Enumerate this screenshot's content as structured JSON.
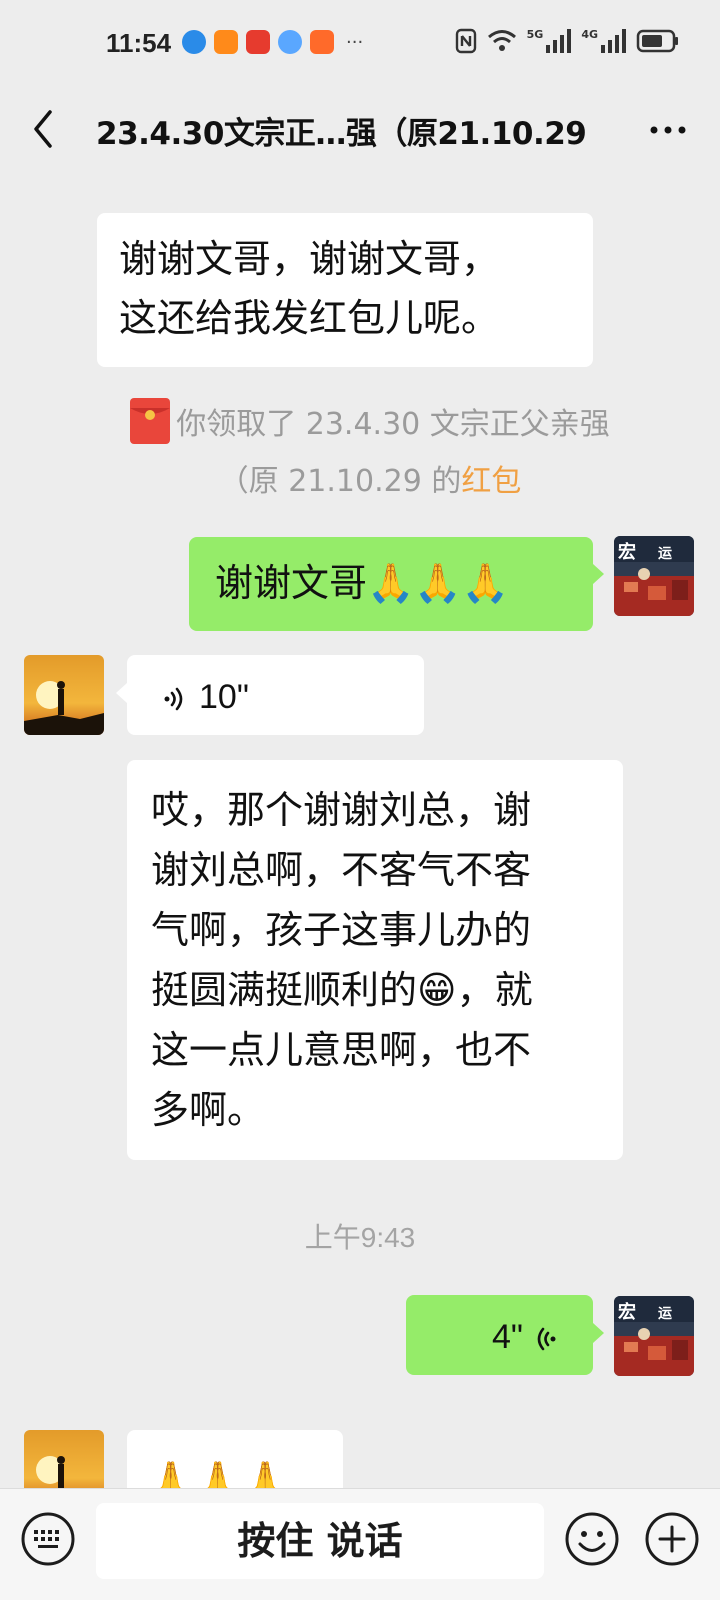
{
  "status_bar": {
    "time": "11:54",
    "more_apps": "···",
    "net1": "5G",
    "net2": "4G"
  },
  "header": {
    "title": "23.4.30文宗正…强（原21.10.29",
    "back_icon": "chevron-left-icon",
    "more_icon": "ellipsis-icon"
  },
  "messages": {
    "m1_text_l1": "谢谢文哥，谢谢文哥，",
    "m1_text_l2": "这还给我发红包儿呢。",
    "system_line1": "你领取了 23.4.30 文宗正父亲强",
    "system_line2_prefix": "（原 21.10.29 的",
    "system_link": "红包",
    "m2_text": "谢谢文哥🙏🙏🙏",
    "m3_voice_duration": "10\"",
    "m4_l1": "哎，那个谢谢刘总，谢",
    "m4_l2": "谢刘总啊，不客气不客",
    "m4_l3": "气啊，孩子这事儿办的",
    "m4_l4": "挺圆满挺顺利的😁，就",
    "m4_l5": "这一点儿意思啊，也不",
    "m4_l6": "多啊。",
    "time_separator": "上午9:43",
    "m5_voice_duration": "4\"",
    "m6_text": "🙏🙏🙏"
  },
  "input_bar": {
    "hold_to_talk": "按住 说话",
    "keyboard_icon": "keyboard-icon",
    "emoji_icon": "emoji-icon",
    "plus_icon": "plus-icon"
  },
  "colors": {
    "green_bubble": "#95ec69",
    "white_bubble": "#ffffff",
    "background": "#ededed",
    "link": "#f0a043"
  }
}
